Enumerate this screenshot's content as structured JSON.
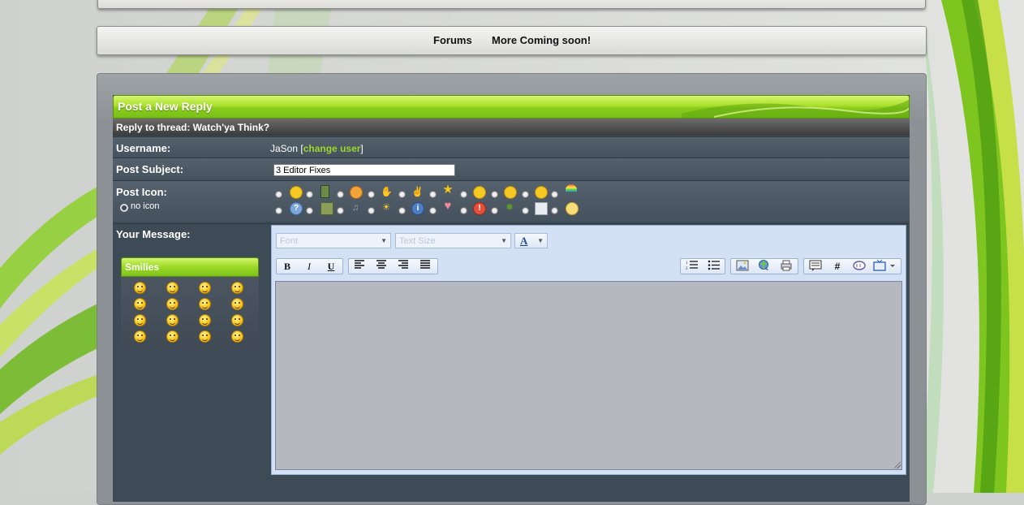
{
  "nav": {
    "forums": "Forums",
    "coming_soon": "More Coming soon!"
  },
  "form": {
    "header_title": "Post a New Reply",
    "thread_line": "Reply to thread: Watch'ya Think?",
    "username_label": "Username:",
    "username_value": "JaSon",
    "change_user_open": "[",
    "change_user_link": "change user",
    "change_user_close": "]",
    "subject_label": "Post Subject:",
    "subject_value": "3 Editor Fixes",
    "post_icon_label": "Post Icon:",
    "no_icon_label": "no icon",
    "message_label": "Your Message:"
  },
  "smilies": {
    "title": "Smilies",
    "count": 16
  },
  "editor": {
    "font_placeholder": "Font",
    "size_placeholder": "Text Size",
    "text_color_icon": "A",
    "bold": "B",
    "italic": "I",
    "underline": "U",
    "hash": "#"
  },
  "colors": {
    "accent_green": "#9ad82b",
    "panel_bg": "#3e4a55",
    "editor_bg": "#d4e0f3"
  }
}
